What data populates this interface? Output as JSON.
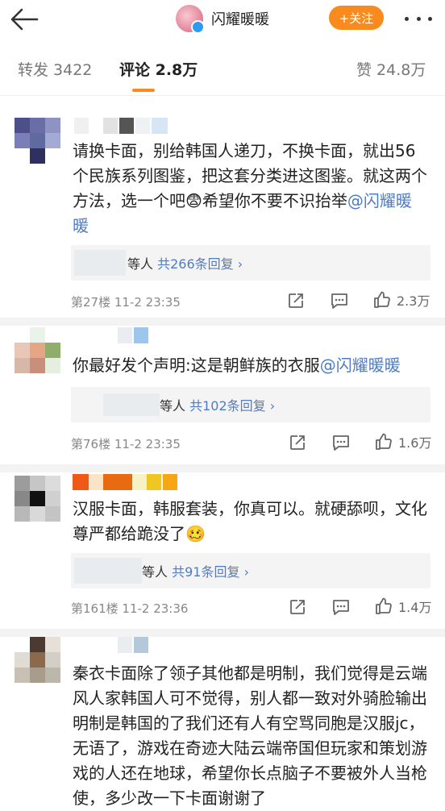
{
  "header": {
    "username": "闪耀暖暖",
    "follow_label": "+关注"
  },
  "tabs": [
    {
      "label": "转发 3422"
    },
    {
      "label": "评论 2.8万"
    },
    {
      "label": "赞 24.8万"
    }
  ],
  "comments": [
    {
      "text_parts": [
        "请换卡面，别给韩国人递刀，不换卡面，就出56个民族系列图鉴，把这套分类进这图鉴。就这两个方法，选一个吧",
        "😨",
        "希望你不要不识抬举",
        "@闪耀暖暖"
      ],
      "reply_prefix": "等人",
      "reply_count": "共266条回复",
      "floor_time": "第27楼  11-2 23:35",
      "likes": "2.3万"
    },
    {
      "text_parts": [
        "你最好发个声明:这是朝鲜族的衣服",
        "@闪耀暖暖"
      ],
      "reply_prefix": "等人",
      "reply_count": "共102条回复",
      "floor_time": "第76楼  11-2 23:35",
      "likes": "1.6万"
    },
    {
      "text_parts": [
        "汉服卡面，韩服套装，你真可以。就硬舔呗，文化尊严都给跪没了",
        "🥴"
      ],
      "reply_prefix": "等人",
      "reply_count": "共91条回复",
      "floor_time": "第161楼  11-2 23:36",
      "likes": "1.4万"
    },
    {
      "text_parts": [
        "秦衣卡面除了领子其他都是明制，我们觉得是云端风人家韩国人可不觉得，别人都一致对外骑脸输出明制是韩国的了我们还有人有空骂同胞是汉服jc，无语了，游戏在奇迹大陆云端帝国但玩家和策划游戏的人还在地球，希望你长点脑子不要被外人当枪使，多少改一下卡面谢谢了"
      ]
    }
  ],
  "colors": {
    "accent": "#f98b1e",
    "link": "#4f7cc2"
  }
}
